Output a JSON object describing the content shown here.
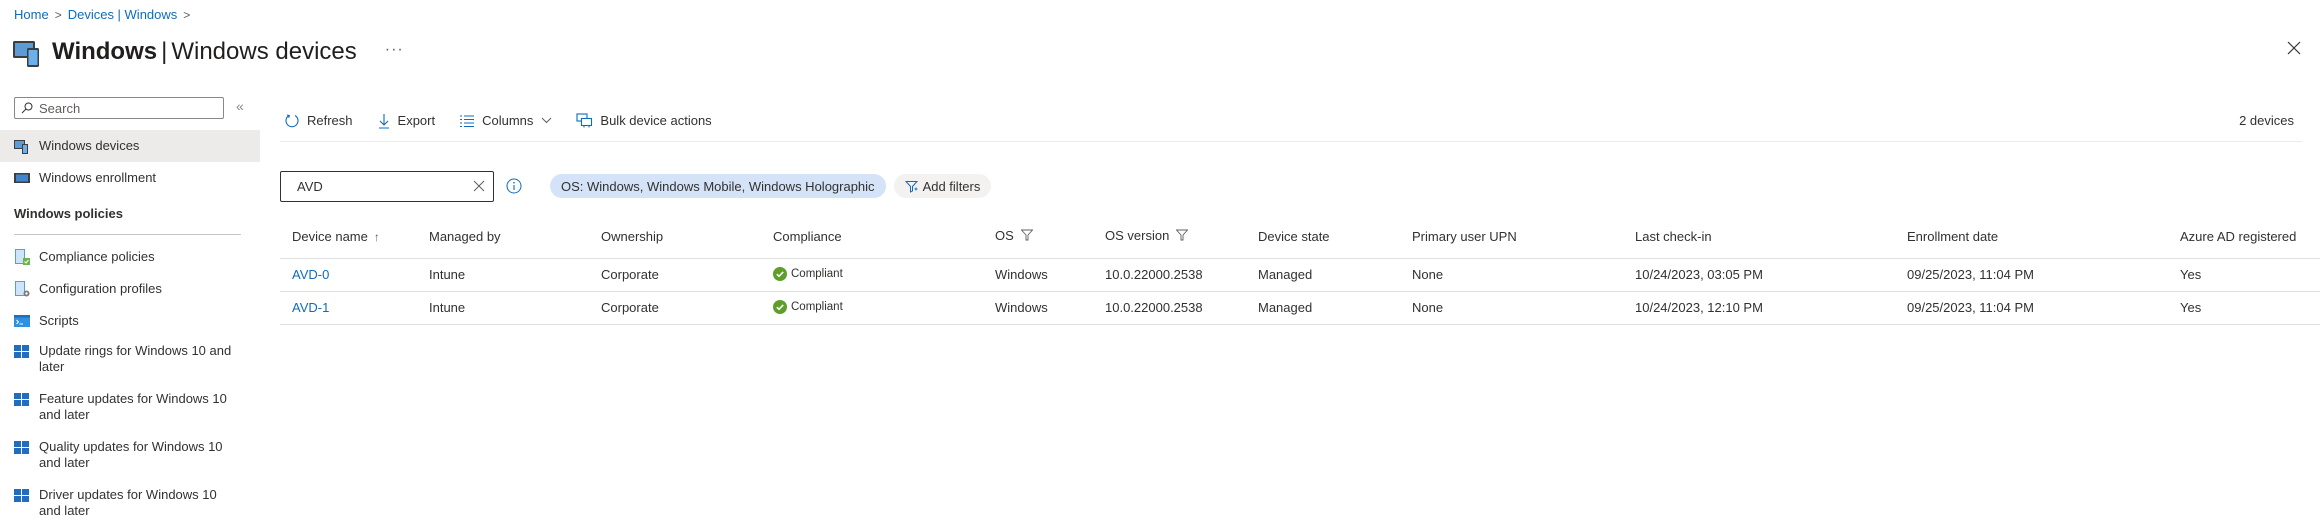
{
  "breadcrumb": [
    {
      "label": "Home"
    },
    {
      "label": "Devices | Windows"
    }
  ],
  "header": {
    "title_bold": "Windows",
    "title_rest": "Windows devices",
    "more": "···",
    "icon": "devices-icon"
  },
  "sidebar": {
    "search_placeholder": "Search",
    "collapse_glyph": "«",
    "items": [
      {
        "label": "Windows devices",
        "icon": "devices-icon",
        "selected": true
      },
      {
        "label": "Windows enrollment",
        "icon": "enrollment-icon"
      }
    ],
    "sections": [
      {
        "title": "Windows policies",
        "items": [
          {
            "label": "Compliance policies",
            "icon": "compliance-policy-icon"
          },
          {
            "label": "Configuration profiles",
            "icon": "configuration-profile-icon"
          },
          {
            "label": "Scripts",
            "icon": "scripts-icon"
          },
          {
            "label": "Update rings for Windows 10 and later",
            "icon": "windows-logo-icon"
          },
          {
            "label": "Feature updates for Windows 10 and later",
            "icon": "windows-logo-icon"
          },
          {
            "label": "Quality updates for Windows 10 and later",
            "icon": "windows-logo-icon"
          },
          {
            "label": "Driver updates for Windows 10 and later",
            "icon": "windows-logo-icon"
          }
        ]
      }
    ]
  },
  "toolbar": {
    "refresh": "Refresh",
    "export": "Export",
    "columns": "Columns",
    "bulk": "Bulk device actions",
    "device_count": "2 devices"
  },
  "filters": {
    "search_value": "AVD",
    "active_filter": "OS: Windows, Windows Mobile, Windows Holographic",
    "add_filters": "Add filters"
  },
  "table": {
    "columns": [
      {
        "label": "Device name",
        "sort": "↑"
      },
      {
        "label": "Managed by"
      },
      {
        "label": "Ownership"
      },
      {
        "label": "Compliance"
      },
      {
        "label": "OS",
        "filter": true
      },
      {
        "label": "OS version",
        "filter": true
      },
      {
        "label": "Device state"
      },
      {
        "label": "Primary user UPN"
      },
      {
        "label": "Last check-in"
      },
      {
        "label": "Enrollment date"
      },
      {
        "label": "Azure AD registered"
      }
    ],
    "rows": [
      {
        "device_name": "AVD-0",
        "managed_by": "Intune",
        "ownership": "Corporate",
        "compliance": "Compliant",
        "os": "Windows",
        "os_version": "10.0.22000.2538",
        "device_state": "Managed",
        "primary_user_upn": "None",
        "last_checkin": "10/24/2023, 03:05 PM",
        "enrollment_date": "09/25/2023, 11:04 PM",
        "aad_registered": "Yes"
      },
      {
        "device_name": "AVD-1",
        "managed_by": "Intune",
        "ownership": "Corporate",
        "compliance": "Compliant",
        "os": "Windows",
        "os_version": "10.0.22000.2538",
        "device_state": "Managed",
        "primary_user_upn": "None",
        "last_checkin": "10/24/2023, 12:10 PM",
        "enrollment_date": "09/25/2023, 11:04 PM",
        "aad_registered": "Yes"
      }
    ]
  },
  "colors": {
    "link": "#0f6cbd",
    "compliant": "#5e9e2b",
    "selected_nav": "#edebe9",
    "active_pill": "#d4e3f7"
  }
}
